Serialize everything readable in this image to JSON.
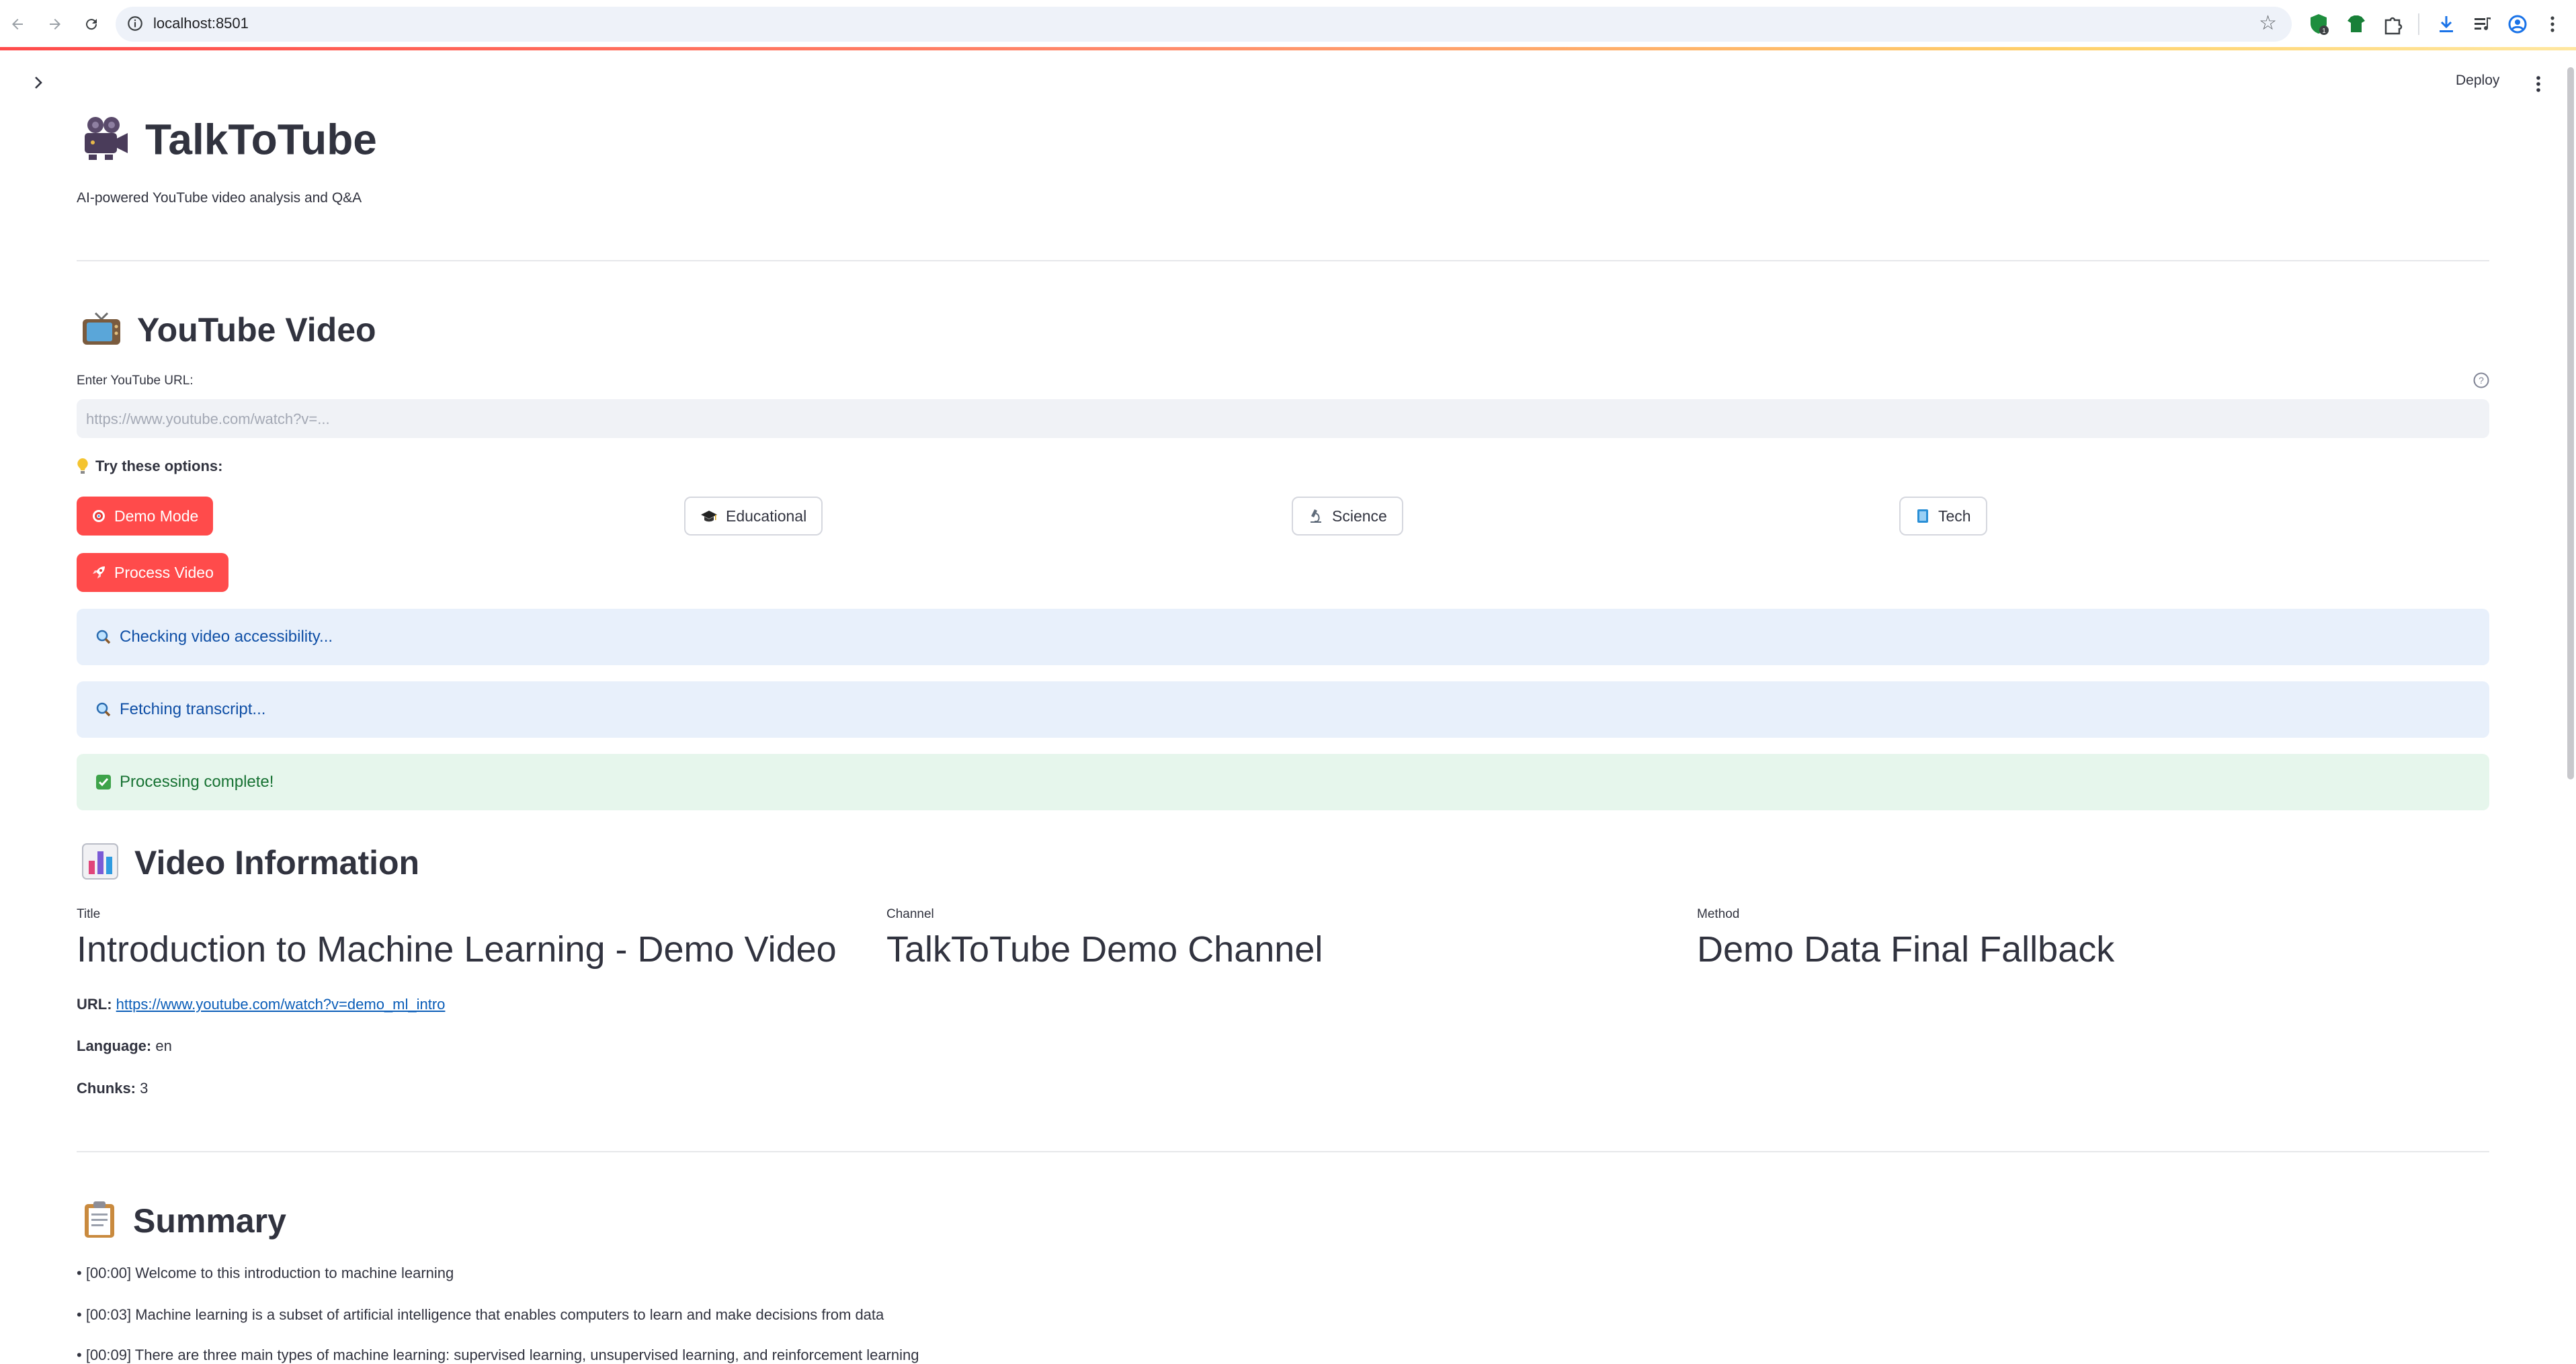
{
  "browser": {
    "url": "localhost:8501",
    "extension_badge": "1"
  },
  "header": {
    "deploy_label": "Deploy"
  },
  "app": {
    "title": "TalkToTube",
    "subtitle": "AI-powered YouTube video analysis and Q&A"
  },
  "youtube_section": {
    "heading": "YouTube Video",
    "input_label": "Enter YouTube URL:",
    "input_placeholder": "https://www.youtube.com/watch?v=...",
    "options_label": "Try these options:",
    "options": [
      {
        "label": "Demo Mode",
        "style": "primary",
        "icon": "target-icon"
      },
      {
        "label": "Educational",
        "style": "secondary",
        "icon": "graduation-cap-icon"
      },
      {
        "label": "Science",
        "style": "secondary",
        "icon": "microscope-icon"
      },
      {
        "label": "Tech",
        "style": "secondary",
        "icon": "book-icon"
      }
    ],
    "process_button": "Process Video"
  },
  "status": [
    {
      "type": "info",
      "text": "Checking video accessibility..."
    },
    {
      "type": "info",
      "text": "Fetching transcript..."
    },
    {
      "type": "success",
      "text": "Processing complete!"
    }
  ],
  "video_info": {
    "heading": "Video Information",
    "metrics": [
      {
        "label": "Title",
        "value": "Introduction to Machine Learning - Demo Video"
      },
      {
        "label": "Channel",
        "value": "TalkToTube Demo Channel"
      },
      {
        "label": "Method",
        "value": "Demo Data Final Fallback"
      }
    ],
    "url_label": "URL:",
    "url_value": "https://www.youtube.com/watch?v=demo_ml_intro",
    "language_label": "Language:",
    "language_value": "en",
    "chunks_label": "Chunks:",
    "chunks_value": "3"
  },
  "summary": {
    "heading": "Summary",
    "items": [
      "• [00:00] Welcome to this introduction to machine learning",
      "• [00:03] Machine learning is a subset of artificial intelligence that enables computers to learn and make decisions from data",
      "• [00:09] There are three main types of machine learning: supervised learning, unsupervised learning, and reinforcement learning"
    ]
  },
  "colors": {
    "primary": "#ff4b4b",
    "info_bg": "#e8f0fb",
    "info_text": "#0f4fa6",
    "success_bg": "#e6f6ec",
    "success_text": "#177233"
  }
}
